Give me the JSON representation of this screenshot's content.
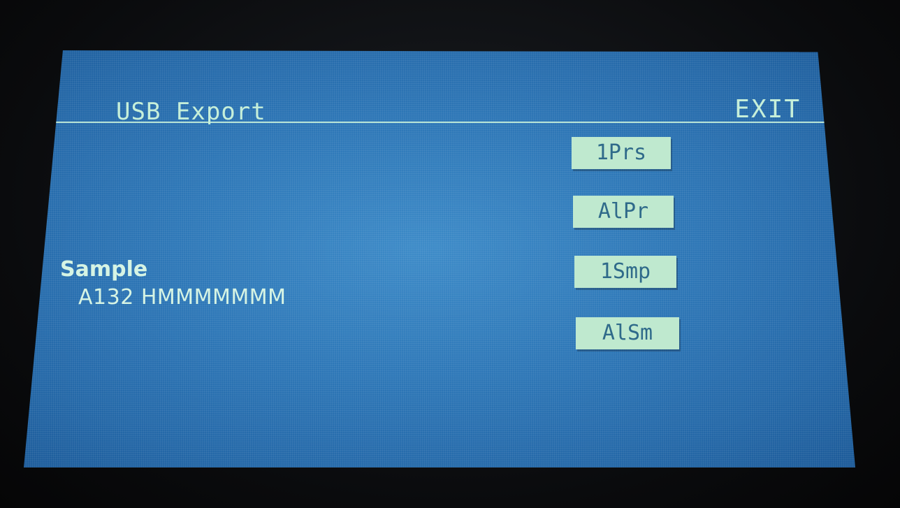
{
  "header": {
    "title": "USB Export",
    "exit_label": "EXIT"
  },
  "buttons": [
    {
      "label": "1Prs"
    },
    {
      "label": "AlPr"
    },
    {
      "label": "1Smp"
    },
    {
      "label": "AlSm"
    }
  ],
  "sample": {
    "label": "Sample",
    "value": "A132 HMMMMMMM"
  },
  "colors": {
    "screen_blue": "#2e78b8",
    "text_mint": "#c6efd9",
    "button_bg": "#bfe9cf",
    "button_text": "#2f6a8a"
  }
}
